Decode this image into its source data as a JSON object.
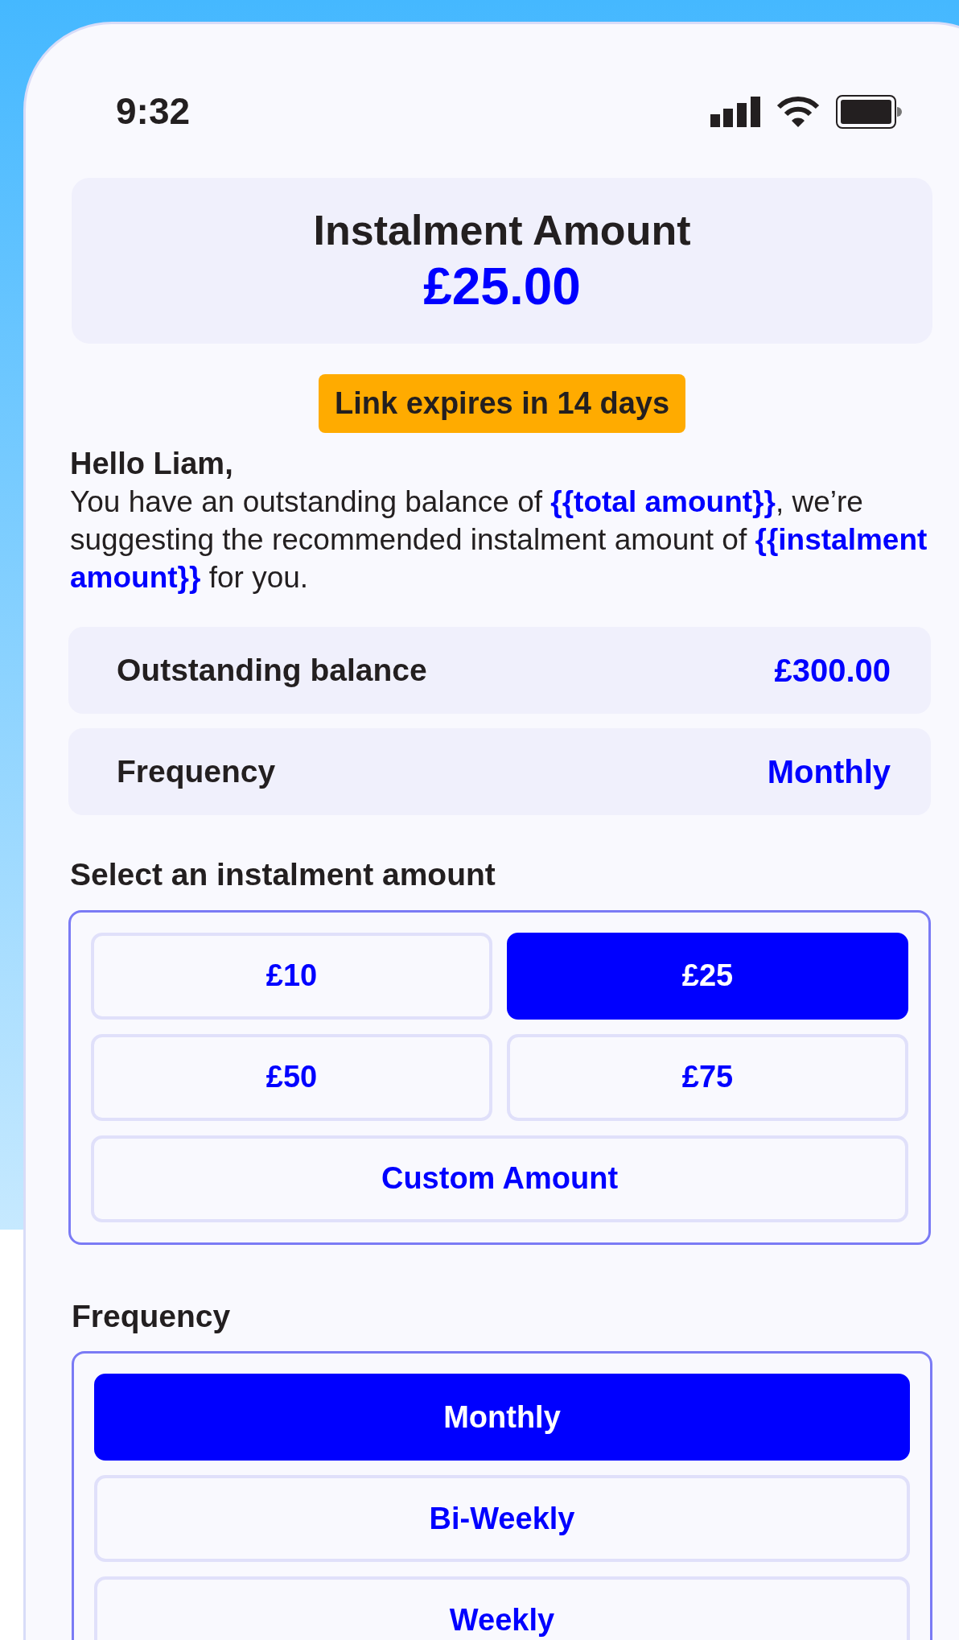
{
  "status_bar": {
    "time": "9:32"
  },
  "header": {
    "title": "Instalment Amount",
    "amount": "£25.00"
  },
  "badge": "Link expires in 14 days",
  "greeting": "Hello Liam,",
  "message": "You have an outstanding balance of **{{total amount}}**, we’re suggesting the recommended instalment amount of **{{instalment amount}}** for you.",
  "summary": [
    {
      "label": "Outstanding balance",
      "value": "£300.00"
    },
    {
      "label": "Frequency",
      "value": "Monthly"
    }
  ],
  "amount_section": {
    "title": "Select an instalment amount",
    "options": [
      {
        "label": "£10",
        "selected": false
      },
      {
        "label": "£25",
        "selected": true
      },
      {
        "label": "£50",
        "selected": false
      },
      {
        "label": "£75",
        "selected": false
      },
      {
        "label": "Custom Amount",
        "selected": false
      }
    ]
  },
  "frequency_section": {
    "title": "Frequency",
    "options": [
      {
        "label": "Monthly",
        "selected": true
      },
      {
        "label": "Bi-Weekly",
        "selected": false
      },
      {
        "label": "Weekly",
        "selected": false
      }
    ]
  }
}
